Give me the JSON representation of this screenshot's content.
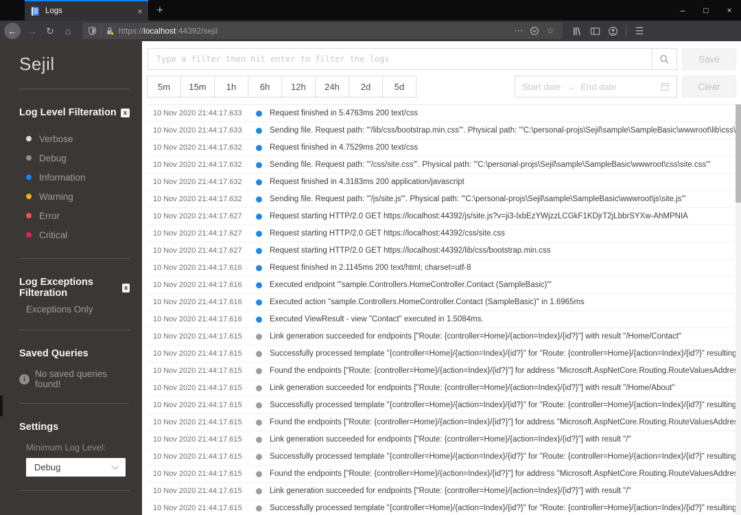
{
  "browser": {
    "tab": {
      "title": "Logs"
    },
    "url": {
      "scheme": "https://",
      "host": "localhost",
      "path": ":44392/sejil"
    },
    "icons": {
      "back": "←",
      "forward": "→",
      "reload": "↻",
      "home": "⌂",
      "page_actions": "⋯",
      "bookmark_star": "☆",
      "menu": "☰",
      "minimize": "–",
      "maximize": "□",
      "close": "×",
      "tab_close": "×",
      "new_tab": "+"
    }
  },
  "sidebar": {
    "title": "Sejil",
    "log_levels": {
      "heading": "Log Level Filteration",
      "close_glyph": "x",
      "items": [
        {
          "label": "Verbose",
          "color": "#dcdcdc"
        },
        {
          "label": "Debug",
          "color": "#8c8c8c"
        },
        {
          "label": "Information",
          "color": "#0d86f8"
        },
        {
          "label": "Warning",
          "color": "#f0ad14"
        },
        {
          "label": "Error",
          "color": "#f0504e"
        },
        {
          "label": "Critical",
          "color": "#e61c68"
        }
      ]
    },
    "exceptions": {
      "heading": "Log Exceptions Filteration",
      "close_glyph": "x",
      "item": "Exceptions Only"
    },
    "saved_queries": {
      "heading": "Saved Queries",
      "info_glyph": "i",
      "empty_message": "No saved queries found!"
    },
    "settings": {
      "heading": "Settings",
      "min_level_label": "Minimum Log Level:",
      "min_level_value": "Debug"
    }
  },
  "filter": {
    "placeholder": "Type a filter then hit enter to filter the logs",
    "save_label": "Save",
    "clear_label": "Clear",
    "time_ranges": [
      "5m",
      "15m",
      "1h",
      "6h",
      "12h",
      "24h",
      "2d",
      "5d"
    ],
    "date_range": {
      "start_placeholder": "Start date",
      "arrow": "→",
      "end_placeholder": "End date"
    }
  },
  "logs": {
    "level_colors": {
      "info": "#1e88e5",
      "debug": "#9e9e9e"
    },
    "rows": [
      {
        "ts": "10 Nov 2020 21:44:17.633",
        "level": "info",
        "msg": "Request finished in 5.4763ms 200 text/css"
      },
      {
        "ts": "10 Nov 2020 21:44:17.633",
        "level": "info",
        "msg": "Sending file. Request path: '\"/lib/css/bootstrap.min.css\"'. Physical path: '\"C:\\personal-projs\\Sejil\\sample\\SampleBasic\\wwwroot\\lib\\css\\bootstrap.min.css\"'"
      },
      {
        "ts": "10 Nov 2020 21:44:17.632",
        "level": "info",
        "msg": "Request finished in 4.7529ms 200 text/css"
      },
      {
        "ts": "10 Nov 2020 21:44:17.632",
        "level": "info",
        "msg": "Sending file. Request path: '\"/css/site.css\"'. Physical path: '\"C:\\personal-projs\\Sejil\\sample\\SampleBasic\\wwwroot\\css\\site.css\"'"
      },
      {
        "ts": "10 Nov 2020 21:44:17.632",
        "level": "info",
        "msg": "Request finished in 4.3183ms 200 application/javascript"
      },
      {
        "ts": "10 Nov 2020 21:44:17.632",
        "level": "info",
        "msg": "Sending file. Request path: '\"/js/site.js\"'. Physical path: '\"C:\\personal-projs\\Sejil\\sample\\SampleBasic\\wwwroot\\js\\site.js\"'"
      },
      {
        "ts": "10 Nov 2020 21:44:17.627",
        "level": "info",
        "msg": "Request starting HTTP/2.0 GET https://localhost:44392/js/site.js?v=ji3-lxbEzYWjzzLCGkF1KDjrT2jLbbrSYXw-AhMPNIA"
      },
      {
        "ts": "10 Nov 2020 21:44:17.627",
        "level": "info",
        "msg": "Request starting HTTP/2.0 GET https://localhost:44392/css/site.css"
      },
      {
        "ts": "10 Nov 2020 21:44:17.627",
        "level": "info",
        "msg": "Request starting HTTP/2.0 GET https://localhost:44392/lib/css/bootstrap.min.css"
      },
      {
        "ts": "10 Nov 2020 21:44:17.616",
        "level": "info",
        "msg": "Request finished in 2.1145ms 200 text/html; charset=utf-8"
      },
      {
        "ts": "10 Nov 2020 21:44:17.616",
        "level": "info",
        "msg": "Executed endpoint '\"sample.Controllers.HomeController.Contact (SampleBasic)\"'"
      },
      {
        "ts": "10 Nov 2020 21:44:17.616",
        "level": "info",
        "msg": "Executed action \"sample.Controllers.HomeController.Contact (SampleBasic)\" in 1.6965ms"
      },
      {
        "ts": "10 Nov 2020 21:44:17.616",
        "level": "info",
        "msg": "Executed ViewResult - view \"Contact\" executed in 1.5084ms."
      },
      {
        "ts": "10 Nov 2020 21:44:17.615",
        "level": "debug",
        "msg": "Link generation succeeded for endpoints [\"Route: {controller=Home}/{action=Index}/{id?}\"] with result \"/Home/Contact\""
      },
      {
        "ts": "10 Nov 2020 21:44:17.615",
        "level": "debug",
        "msg": "Successfully processed template \"{controller=Home}/{action=Index}/{id?}\" for \"Route: {controller=Home}/{action=Index}/{id?}\" resulting in \"/Home/Contact\" and \"\""
      },
      {
        "ts": "10 Nov 2020 21:44:17.615",
        "level": "debug",
        "msg": "Found the endpoints [\"Route: {controller=Home}/{action=Index}/{id?}\"] for address \"Microsoft.AspNetCore.Routing.RouteValuesAddress\""
      },
      {
        "ts": "10 Nov 2020 21:44:17.615",
        "level": "debug",
        "msg": "Link generation succeeded for endpoints [\"Route: {controller=Home}/{action=Index}/{id?}\"] with result \"/Home/About\""
      },
      {
        "ts": "10 Nov 2020 21:44:17.615",
        "level": "debug",
        "msg": "Successfully processed template \"{controller=Home}/{action=Index}/{id?}\" for \"Route: {controller=Home}/{action=Index}/{id?}\" resulting in \"/Home/About\" and \"\""
      },
      {
        "ts": "10 Nov 2020 21:44:17.615",
        "level": "debug",
        "msg": "Found the endpoints [\"Route: {controller=Home}/{action=Index}/{id?}\"] for address \"Microsoft.AspNetCore.Routing.RouteValuesAddress\""
      },
      {
        "ts": "10 Nov 2020 21:44:17.615",
        "level": "debug",
        "msg": "Link generation succeeded for endpoints [\"Route: {controller=Home}/{action=Index}/{id?}\"] with result \"/\""
      },
      {
        "ts": "10 Nov 2020 21:44:17.615",
        "level": "debug",
        "msg": "Successfully processed template \"{controller=Home}/{action=Index}/{id?}\" for \"Route: {controller=Home}/{action=Index}/{id?}\" resulting in \"\" and \"\""
      },
      {
        "ts": "10 Nov 2020 21:44:17.615",
        "level": "debug",
        "msg": "Found the endpoints [\"Route: {controller=Home}/{action=Index}/{id?}\"] for address \"Microsoft.AspNetCore.Routing.RouteValuesAddress\""
      },
      {
        "ts": "10 Nov 2020 21:44:17.615",
        "level": "debug",
        "msg": "Link generation succeeded for endpoints [\"Route: {controller=Home}/{action=Index}/{id?}\"] with result \"/\""
      },
      {
        "ts": "10 Nov 2020 21:44:17.615",
        "level": "debug",
        "msg": "Successfully processed template \"{controller=Home}/{action=Index}/{id?}\" for \"Route: {controller=Home}/{action=Index}/{id?}\" resulting in \"\" and \"\""
      }
    ]
  }
}
